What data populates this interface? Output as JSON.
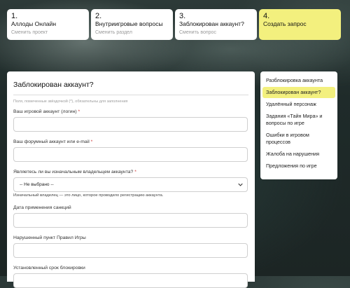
{
  "steps": [
    {
      "num": "1.",
      "title": "Аллоды Онлайн",
      "change": "Сменить проект"
    },
    {
      "num": "2.",
      "title": "Внутриигровые вопросы",
      "change": "Сменить раздел"
    },
    {
      "num": "3.",
      "title": "Заблокирован аккаунт?",
      "change": "Сменить вопрос"
    },
    {
      "num": "4.",
      "title": "Создать запрос"
    }
  ],
  "form": {
    "title": "Заблокирован аккаунт?",
    "note": "Поля, помеченные звёздочкой (*), обязательны для заполнения",
    "required_mark": "*",
    "fields": [
      {
        "label": "Ваш игровой аккаунт (логин)",
        "required": true,
        "value": ""
      },
      {
        "label": "Ваш форумный аккаунт или e-mail",
        "required": true,
        "value": ""
      },
      {
        "label": "Являетесь ли вы изначальным владельцем аккаунта?",
        "required": true,
        "selected": "-- Не выбрано --",
        "help": "Изначальный владелец — это лицо, которое проводило регистрацию аккаунта."
      },
      {
        "label": "Дата применения санкций",
        "value": ""
      },
      {
        "label": "Нарушенный пункт Правил Игры",
        "value": ""
      },
      {
        "label": "Установленный срок блокировки",
        "value": ""
      }
    ]
  },
  "sidebar": {
    "items": [
      {
        "label": "Разблокировка аккаунта",
        "active": false
      },
      {
        "label": "Заблокирован аккаунт?",
        "active": true
      },
      {
        "label": "Удалённый персонаж",
        "active": false
      },
      {
        "label": "Задания «Тайн Мира» и вопросы по игре",
        "active": false
      },
      {
        "label": "Ошибки в игровом процессов",
        "active": false
      },
      {
        "label": "Жалоба на нарушения",
        "active": false
      },
      {
        "label": "Предложения по игре",
        "active": false
      }
    ]
  },
  "colors": {
    "accent": "#f3f07e",
    "required": "#c33333"
  }
}
